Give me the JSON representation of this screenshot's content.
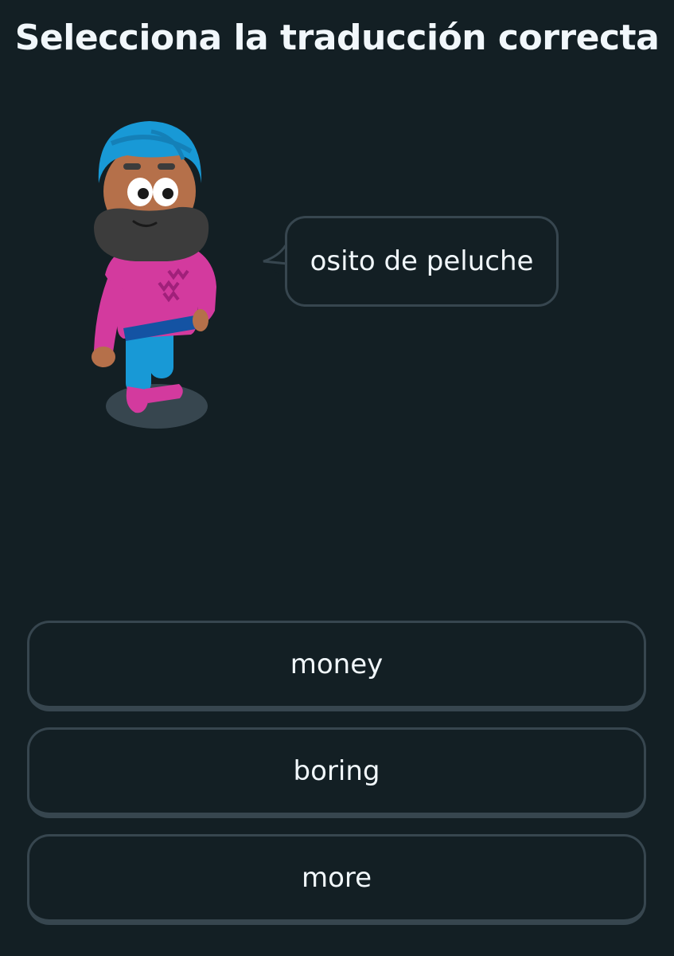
{
  "header": {
    "title": "Selecciona la traducción correcta"
  },
  "prompt": {
    "character_icon": "turbaned-man-character-icon",
    "speech_text": "osito de peluche"
  },
  "options": [
    {
      "label": "money"
    },
    {
      "label": "boring"
    },
    {
      "label": "more"
    }
  ],
  "colors": {
    "background": "#131f24",
    "border": "#37464f",
    "text": "#f1f7fb",
    "turban": "#1899d6",
    "sweater": "#d33a9e",
    "pants": "#1899d6",
    "skin": "#b5704a",
    "beard": "#3c3c3c"
  }
}
